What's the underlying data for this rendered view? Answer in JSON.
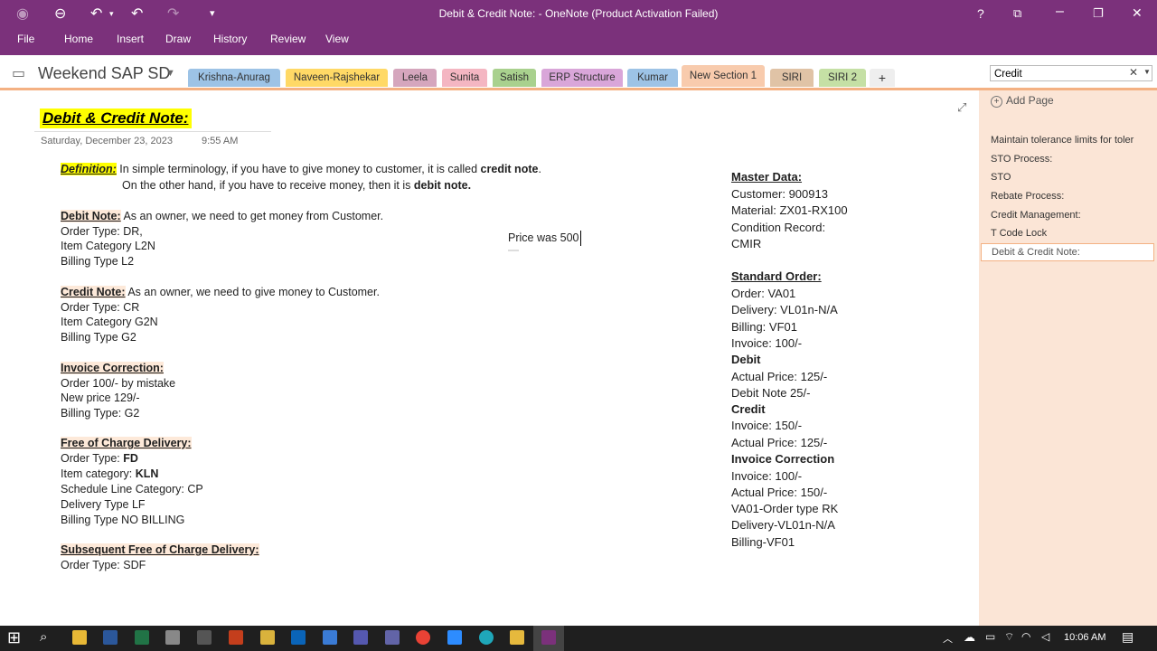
{
  "window": {
    "title": "Debit & Credit Note: - OneNote (Product Activation Failed)"
  },
  "ribbon": {
    "tabs": [
      "File",
      "Home",
      "Insert",
      "Draw",
      "History",
      "Review",
      "View"
    ]
  },
  "notebook": {
    "name": "Weekend SAP SD"
  },
  "sections": [
    {
      "label": "Krishna-Anurag",
      "color": "#9dc3e6"
    },
    {
      "label": "Naveen-Rajshekar",
      "color": "#ffd966"
    },
    {
      "label": "Leela",
      "color": "#d5a6bd"
    },
    {
      "label": "Sunita",
      "color": "#f4b6c2"
    },
    {
      "label": "Satish",
      "color": "#a9d18e"
    },
    {
      "label": "ERP Structure",
      "color": "#d9a6d9"
    },
    {
      "label": "Kumar",
      "color": "#9dc3e6"
    },
    {
      "label": "New Section 1",
      "color": "#f8cbad"
    },
    {
      "label": "SIRI",
      "color": "#e0c3a6"
    },
    {
      "label": "SIRI 2",
      "color": "#c5e0a5"
    }
  ],
  "search": {
    "value": "Credit"
  },
  "pages": {
    "add_page": "Add Page",
    "items": [
      "Maintain tolerance limits for toler",
      "STO Process:",
      "STO",
      "Rebate Process:",
      "Credit Management:",
      "T Code Lock",
      "Debit & Credit Note:"
    ]
  },
  "note": {
    "title": "Debit & Credit Note:",
    "date": "Saturday, December 23, 2023",
    "time": "9:55 AM",
    "def_label": "Definition:",
    "def_line1": "In simple terminology, if you have to give money to customer, it is called ",
    "def_bold1": "credit note",
    "def_line2": "On the other hand, if you have to receive money, then it is ",
    "def_bold2": "debit note.",
    "debit_hdr": "Debit Note:",
    "debit_desc": "As an owner, we need to get money from Customer.",
    "debit_lines": [
      "Order Type: DR,",
      "Item Category L2N",
      "Billing Type L2"
    ],
    "credit_hdr": "Credit Note:",
    "credit_desc": "As an owner, we need to give money to Customer.",
    "credit_lines": [
      "Order Type: CR",
      "Item Category G2N",
      "Billing Type G2"
    ],
    "inv_hdr": "Invoice Correction:",
    "inv_lines": [
      "Order 100/- by mistake",
      "New price 129/-",
      "Billing Type: G2"
    ],
    "foc_hdr": "Free of Charge Delivery:",
    "foc_l1a": "Order Type: ",
    "foc_l1b": "FD",
    "foc_l2a": "Item category: ",
    "foc_l2b": "KLN",
    "foc_lines": [
      "Schedule Line Category: CP",
      "Delivery Type LF",
      "Billing Type NO BILLING"
    ],
    "sub_hdr": "Subsequent Free of Charge Delivery:",
    "sub_line": "Order Type: SDF",
    "float_text": "Price was 500"
  },
  "right": {
    "master_hdr": "Master Data:",
    "master_lines": [
      "Customer: 900913",
      "Material: ZX01-RX100",
      "Condition Record:",
      "CMIR"
    ],
    "std_hdr": "Standard Order:",
    "std_lines": [
      "Order: VA01",
      "Delivery: VL01n-N/A",
      "Billing: VF01",
      "Invoice: 100/-"
    ],
    "debit_label": "Debit",
    "debit_lines": [
      "Actual Price: 125/-",
      "Debit Note 25/-"
    ],
    "credit_label": "Credit",
    "credit_lines": [
      "Invoice: 150/-",
      "Actual Price: 125/-"
    ],
    "invc_label": "Invoice Correction",
    "invc_lines": [
      "Invoice:  100/-",
      "Actual Price: 150/-",
      "VA01-Order type RK",
      "Delivery-VL01n-N/A",
      "Billing-VF01"
    ]
  },
  "taskbar": {
    "time": "10:06 AM"
  }
}
